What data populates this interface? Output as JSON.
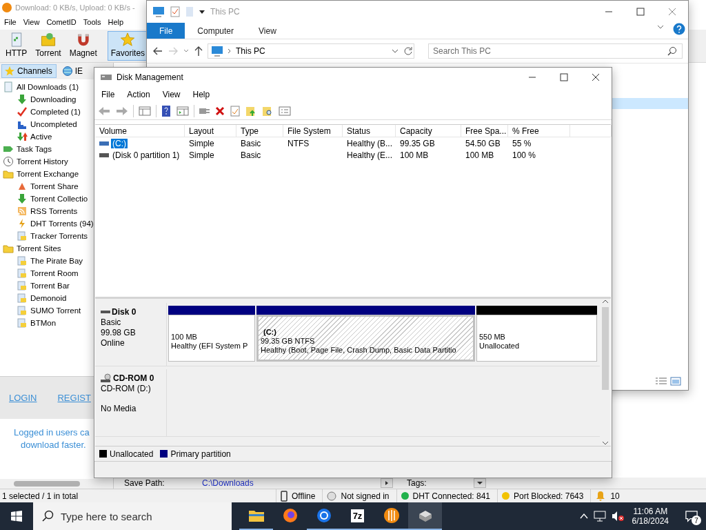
{
  "bitcomet": {
    "title": "Download: 0 KB/s, Upload: 0 KB/s -",
    "menu": [
      "File",
      "View",
      "CometID",
      "Tools",
      "Help"
    ],
    "toolbar": [
      {
        "label": "HTTP",
        "kind": "http",
        "selected": false
      },
      {
        "label": "Torrent",
        "kind": "torrent",
        "selected": false
      },
      {
        "label": "Magnet",
        "kind": "magnet",
        "selected": false
      },
      {
        "label": "Favorites",
        "kind": "favorites",
        "selected": true
      }
    ],
    "panel_tabs": [
      {
        "label": "Channels",
        "kind": "star",
        "selected": true
      },
      {
        "label": "IE",
        "kind": "globe",
        "selected": false
      }
    ],
    "tree": [
      {
        "label": "All Downloads (1)",
        "children": [
          {
            "label": "Downloading"
          },
          {
            "label": "Completed (1)"
          },
          {
            "label": "Uncompleted"
          },
          {
            "label": "Active"
          }
        ]
      },
      {
        "label": "Task Tags"
      },
      {
        "label": "Torrent History"
      },
      {
        "label": "Torrent Exchange",
        "children": [
          {
            "label": "Torrent Share"
          },
          {
            "label": "Torrent Collectio"
          },
          {
            "label": "RSS Torrents"
          },
          {
            "label": "DHT Torrents (94)"
          },
          {
            "label": "Tracker Torrents"
          }
        ]
      },
      {
        "label": "Torrent Sites",
        "children": [
          {
            "label": "The Pirate Bay"
          },
          {
            "label": "Torrent Room"
          },
          {
            "label": "Torrent Bar"
          },
          {
            "label": "Demonoid"
          },
          {
            "label": "SUMO Torrent"
          },
          {
            "label": "BTMon"
          }
        ]
      }
    ],
    "links": [
      "LOGIN",
      "REGIST"
    ],
    "login_note": [
      "Logged in users ca",
      "download faster."
    ],
    "details": {
      "save_path_label": "Save Path:",
      "save_path": "C:\\Downloads",
      "tags_label": "Tags:"
    },
    "status_bar": {
      "selection": "1 selected / 1 in total",
      "items": [
        {
          "text": "Offline",
          "kind": "phone"
        },
        {
          "text": "Not signed in",
          "kind": "globe"
        },
        {
          "text": "DHT Connected: 841",
          "kind": "dot",
          "color": "#22b14c"
        },
        {
          "text": "Port Blocked: 7643",
          "kind": "dot",
          "color": "#f2c200"
        },
        {
          "text": "10",
          "kind": "bell"
        }
      ]
    }
  },
  "explorer": {
    "title": "This PC",
    "ribbon_tabs": [
      {
        "label": "File",
        "selected": true
      },
      {
        "label": "Computer",
        "selected": false
      },
      {
        "label": "View",
        "selected": false
      }
    ],
    "address": "This PC",
    "search": {
      "placeholder": "Search This PC"
    }
  },
  "disk_management": {
    "title": "Disk Management",
    "menu": [
      "File",
      "Action",
      "View",
      "Help"
    ],
    "columns": [
      "Volume",
      "Layout",
      "Type",
      "File System",
      "Status",
      "Capacity",
      "Free Spa...",
      "% Free"
    ],
    "volumes": [
      {
        "volume": "(C:)",
        "layout": "Simple",
        "type": "Basic",
        "file_system": "NTFS",
        "status": "Healthy (B...",
        "capacity": "99.35 GB",
        "free_space": "54.50 GB",
        "percent_free": "55 %",
        "selected": true
      },
      {
        "volume": "(Disk 0 partition 1)",
        "layout": "Simple",
        "type": "Basic",
        "status": "Healthy (E...",
        "capacity": "100 MB",
        "free_space": "100 MB",
        "percent_free": "100 %",
        "selected": false
      }
    ],
    "disks": [
      {
        "kind": "disk",
        "name": "Disk 0",
        "type": "Basic",
        "size": "99.98 GB",
        "state": "Online",
        "partitions": [
          {
            "kind": "primary",
            "size": "100 MB",
            "status": "Healthy (EFI System P",
            "selected": false
          },
          {
            "kind": "primary",
            "label": "(C:)",
            "size": "99.35 GB NTFS",
            "status": "Healthy (Boot, Page File, Crash Dump, Basic Data Partitio",
            "selected": true
          },
          {
            "kind": "unallocated",
            "size": "550 MB",
            "status": "Unallocated",
            "selected": false
          }
        ]
      },
      {
        "kind": "cdrom",
        "name": "CD-ROM 0",
        "drive": "CD-ROM (D:)",
        "media": "No Media"
      }
    ],
    "legend": [
      {
        "label": "Unallocated",
        "color": "#000000"
      },
      {
        "label": "Primary partition",
        "color": "#000080"
      }
    ]
  },
  "taskbar": {
    "search": {
      "placeholder": "Type here to search"
    },
    "apps": [
      {
        "kind": "folder",
        "running": true,
        "selected": false
      },
      {
        "kind": "firefox",
        "running": false,
        "selected": false
      },
      {
        "kind": "chrome",
        "running": true,
        "selected": false
      },
      {
        "kind": "sevenzip",
        "label": "7z",
        "running": true,
        "selected": false
      },
      {
        "kind": "bitcomet",
        "running": true,
        "selected": false
      },
      {
        "kind": "diskmgmt",
        "running": true,
        "selected": true
      }
    ],
    "time": "11:06 AM",
    "date": "6/18/2024",
    "notifications": "7"
  }
}
